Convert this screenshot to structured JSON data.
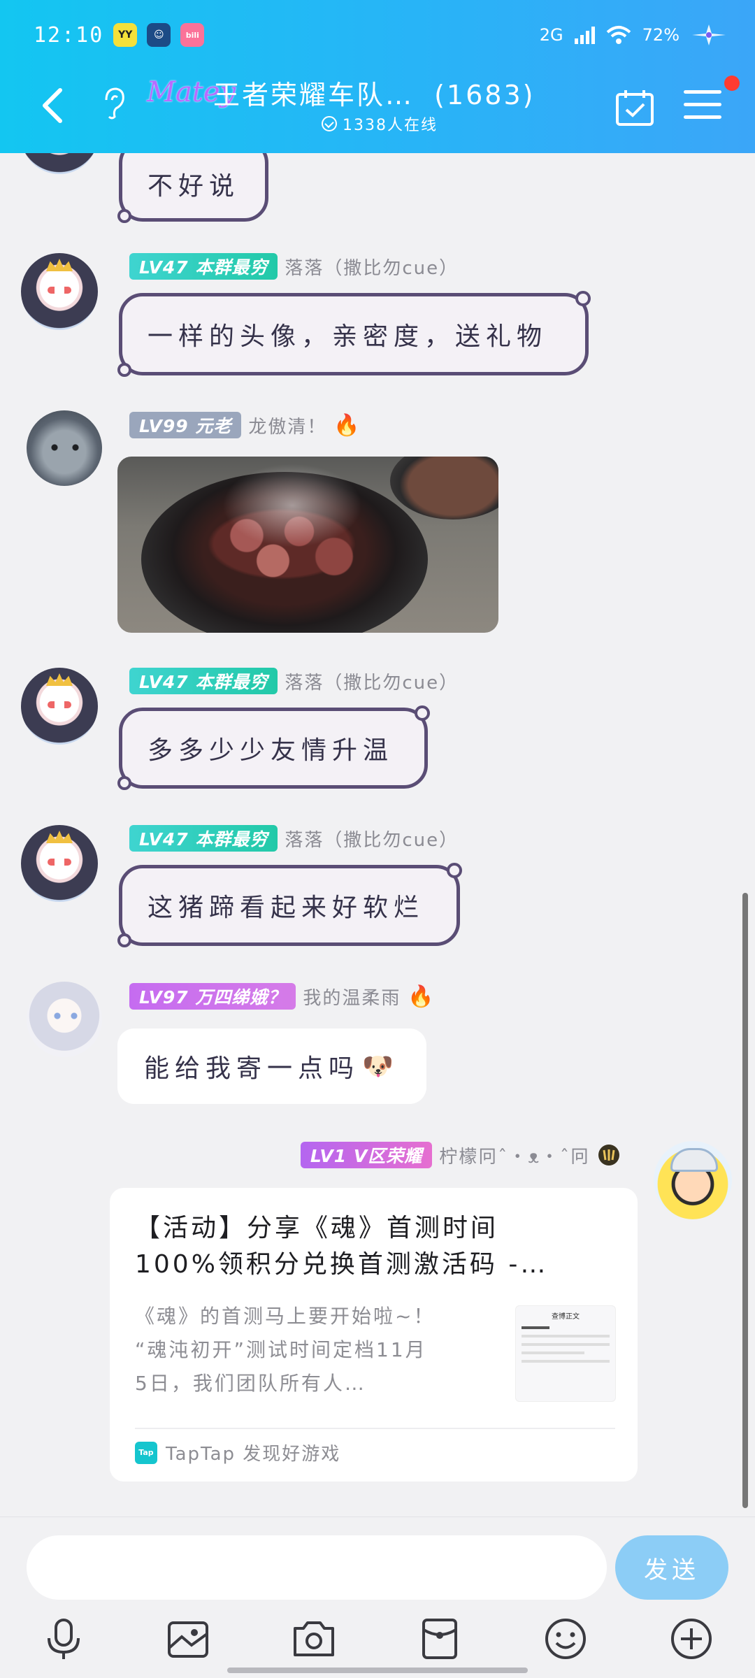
{
  "status_bar": {
    "time": "12:10",
    "network": "2G",
    "battery": "72%",
    "app_icons": [
      "yy-app-icon",
      "emoji-app-icon",
      "bilibili-app-icon"
    ]
  },
  "header": {
    "logo_text": "Matey",
    "group_name": "王者荣耀车队…",
    "member_count": "(1683)",
    "online_text": "1338人在线",
    "has_notification": true,
    "background_colors": [
      "#13c6f1",
      "#3ba6f8"
    ]
  },
  "messages": [
    {
      "type": "text",
      "bubble": "decorated",
      "text": "不好说",
      "avatar": "anime-girl-crown-avatar"
    },
    {
      "type": "text",
      "bubble": "decorated",
      "badge": "LV47 本群最穷",
      "badge_style": "green",
      "nickname": "落落（撒比勿cue）",
      "text": "一样的头像，亲密度，送礼物",
      "avatar": "anime-girl-crown-avatar"
    },
    {
      "type": "image",
      "badge": "LV99 元老",
      "badge_style": "gray",
      "nickname": "龙傲清！",
      "flame": "🔥",
      "image": "pig-trotters-in-wok-photo",
      "avatar": "grey-cat-avatar"
    },
    {
      "type": "text",
      "bubble": "decorated",
      "badge": "LV47 本群最穷",
      "badge_style": "green",
      "nickname": "落落（撒比勿cue）",
      "text": "多多少少友情升温",
      "avatar": "anime-girl-crown-avatar"
    },
    {
      "type": "text",
      "bubble": "decorated",
      "badge": "LV47 本群最穷",
      "badge_style": "green",
      "nickname": "落落（撒比勿cue）",
      "text": "这猪蹄看起来好软烂",
      "avatar": "anime-girl-crown-avatar"
    },
    {
      "type": "text",
      "bubble": "white",
      "badge": "LV97 万四绨娥？",
      "badge_style": "purple",
      "nickname": "我的温柔雨",
      "flame": "🔥",
      "text": "能给我寄一点吗",
      "emoji": "🐶",
      "avatar": "anime-girl-white-hair-avatar"
    },
    {
      "type": "card",
      "self": true,
      "badge": "LV1 V区荣耀",
      "badge_style": "pink",
      "nickname": "柠檬冋ˆ・ᴥ・ˆ冋",
      "avatar": "crayon-shin-chan-avatar",
      "card": {
        "title_line1": "【活动】分享《魂》首测时间",
        "title_line2": "100%领积分兑换首测激活码 -…",
        "desc_line1": "《魂》的首测马上要开始啦~！",
        "desc_line2": "“魂沌初开”测试时间定档11月",
        "desc_line3": "5日，我们团队所有人…",
        "thumb_header": "查博正文",
        "source_logo": "Tap",
        "source": "TapTap 发现好游戏"
      }
    }
  ],
  "input": {
    "placeholder": "",
    "value": "",
    "send_label": "发送",
    "send_color": "#8ccdf6"
  },
  "toolbar": {
    "icons": [
      "microphone-icon",
      "gallery-icon",
      "camera-icon",
      "red-packet-icon",
      "emoji-icon",
      "plus-icon"
    ]
  }
}
